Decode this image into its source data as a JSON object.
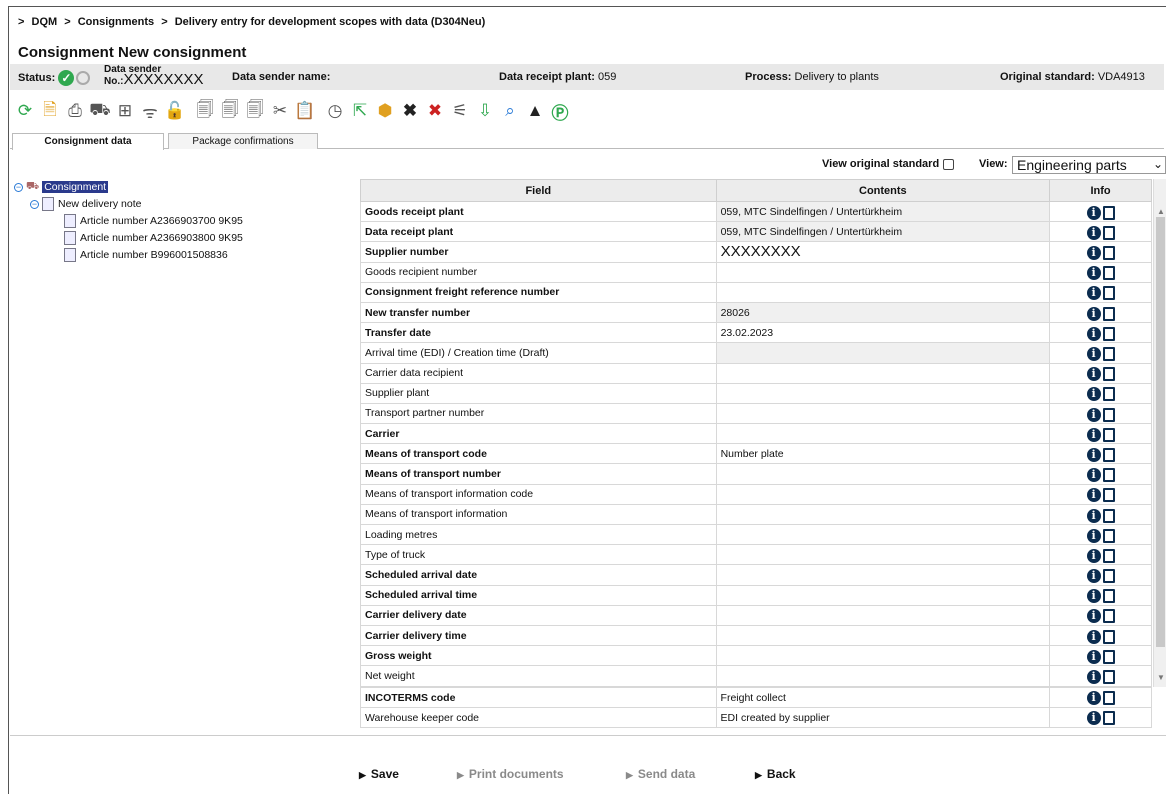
{
  "breadcrumb": {
    "sep": ">",
    "items": [
      "DQM",
      "Consignments",
      "Delivery entry for development scopes with data  (D304Neu)"
    ]
  },
  "title": "Consignment New consignment",
  "status": {
    "status_label": "Status:",
    "data_sender_label": "Data sender",
    "no_label": "No.:",
    "no_value": "XXXXXXXX",
    "data_sender_name_label": "Data sender name:",
    "data_receipt_plant_label": "Data receipt plant:",
    "data_receipt_plant_value": "059",
    "process_label": "Process:",
    "process_value": "Delivery to plants",
    "original_standard_label": "Original standard:",
    "original_standard_value": "VDA4913"
  },
  "tabs": [
    "Consignment data",
    "Package confirmations"
  ],
  "view": {
    "original_standard_label": "View original standard",
    "view_label": "View:",
    "view_value": "Engineering parts"
  },
  "tree": {
    "root": "Consignment",
    "child": "New delivery note",
    "articles": [
      "Article number A2366903700 9K95",
      "Article number A2366903800 9K95",
      "Article number B996001508836"
    ]
  },
  "table": {
    "headers": [
      "Field",
      "Contents",
      "Info"
    ],
    "rows": [
      {
        "field": "Goods receipt plant",
        "value": "059, MTC Sindelfingen / Untertürkheim",
        "bold": true,
        "shaded": true
      },
      {
        "field": "Data receipt plant",
        "value": "059, MTC Sindelfingen / Untertürkheim",
        "bold": true,
        "shaded": true
      },
      {
        "field": "Supplier number",
        "value": "XXXXXXXX",
        "bold": true,
        "big": true
      },
      {
        "field": "Goods recipient number",
        "value": "",
        "bold": false
      },
      {
        "field": "Consignment freight reference number",
        "value": "",
        "bold": true
      },
      {
        "field": "New transfer number",
        "value": "28026",
        "bold": true,
        "shaded": true
      },
      {
        "field": "Transfer date",
        "value": "23.02.2023",
        "bold": true
      },
      {
        "field": "Arrival time (EDI) / Creation time (Draft)",
        "value": "",
        "bold": false,
        "shaded": true
      },
      {
        "field": "Carrier data recipient",
        "value": "",
        "bold": false
      },
      {
        "field": "Supplier plant",
        "value": "",
        "bold": false
      },
      {
        "field": "Transport partner number",
        "value": "",
        "bold": false
      },
      {
        "field": "Carrier",
        "value": "",
        "bold": true
      },
      {
        "field": "Means of transport code",
        "value": "Number plate",
        "bold": true
      },
      {
        "field": "Means of transport number",
        "value": "",
        "bold": true
      },
      {
        "field": "Means of transport information code",
        "value": "",
        "bold": false
      },
      {
        "field": "Means of transport information",
        "value": "",
        "bold": false
      },
      {
        "field": "Loading metres",
        "value": "",
        "bold": false
      },
      {
        "field": "Type of truck",
        "value": "",
        "bold": false
      },
      {
        "field": "Scheduled arrival date",
        "value": "",
        "bold": true
      },
      {
        "field": "Scheduled arrival time",
        "value": "",
        "bold": true
      },
      {
        "field": "Carrier delivery date",
        "value": "",
        "bold": true
      },
      {
        "field": "Carrier delivery time",
        "value": "",
        "bold": true
      },
      {
        "field": "Gross weight",
        "value": "",
        "bold": true
      },
      {
        "field": "Net weight",
        "value": "",
        "bold": false
      }
    ],
    "extra_rows": [
      {
        "field": "INCOTERMS code",
        "value": "Freight collect",
        "bold": true
      },
      {
        "field": "Warehouse keeper code",
        "value": "EDI created by supplier",
        "bold": false
      }
    ]
  },
  "actions": [
    "Save",
    "Print documents",
    "Send data",
    "Back"
  ]
}
